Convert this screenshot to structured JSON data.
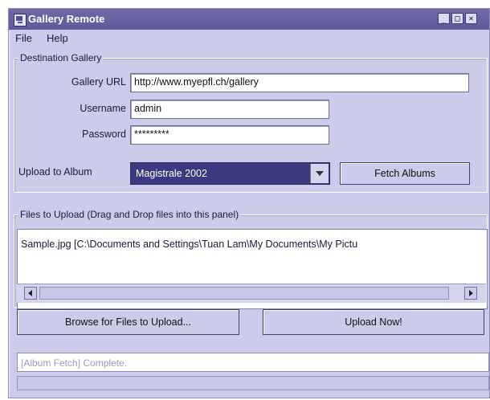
{
  "window": {
    "title": "Gallery Remote",
    "controls": {
      "minimize_glyph": "_",
      "maximize_glyph": "□",
      "close_glyph": "×"
    }
  },
  "menu": {
    "file": "File",
    "help": "Help"
  },
  "destination": {
    "group_title": "Destination Gallery",
    "gallery_url_label": "Gallery URL",
    "gallery_url_value": "http://www.myepfl.ch/gallery",
    "username_label": "Username",
    "username_value": "admin",
    "password_label": "Password",
    "password_value": "*********",
    "upload_album_label": "Upload to Album",
    "album_selected": "Magistrale 2002",
    "fetch_albums_button": "Fetch Albums"
  },
  "files": {
    "group_title": "Files to Upload (Drag and Drop files into this panel)",
    "items": [
      "Sample.jpg [C:\\Documents and Settings\\Tuan Lam\\My Documents\\My Pictu"
    ]
  },
  "actions": {
    "browse_button": "Browse for Files to Upload...",
    "upload_button": "Upload Now!"
  },
  "status": {
    "message": "[Album Fetch] Complete.",
    "progress_fraction": 0
  },
  "icons": {
    "app": "gallery-app-icon",
    "dropdown": "chevron-down-icon",
    "scroll_left": "arrow-left-icon",
    "scroll_right": "arrow-right-icon"
  }
}
